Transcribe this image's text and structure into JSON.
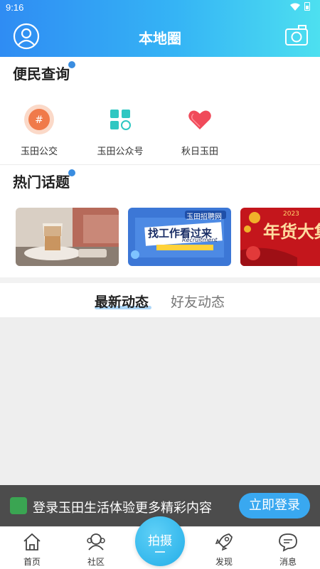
{
  "status_bar": {
    "time": "9:16",
    "wifi_icon": "wifi-icon",
    "battery_icon": "battery-icon"
  },
  "header": {
    "title": "本地圈",
    "left_icon": "user-avatar-icon",
    "right_icon": "camera-icon"
  },
  "services": {
    "title": "便民查询",
    "items": [
      {
        "label": "玉田公交",
        "icon": "hashtag-circle-icon",
        "color": "#f07a4a"
      },
      {
        "label": "玉田公众号",
        "icon": "grid-apps-icon",
        "color": "#2fc7c2"
      },
      {
        "label": "秋日玉田",
        "icon": "heart-icon",
        "color": "#f04a5a"
      }
    ]
  },
  "topics": {
    "title": "热门话题",
    "cards": [
      {
        "icon": "coffee-photo"
      },
      {
        "title": "找工作看过来",
        "badge": "玉田招聘网",
        "subtitle": "Recruitment"
      },
      {
        "title": "年货大集",
        "year": "2023"
      }
    ]
  },
  "feed_tabs": [
    {
      "label": "最新动态",
      "active": true
    },
    {
      "label": "好友动态",
      "active": false
    }
  ],
  "login_banner": {
    "text": "登录玉田生活体验更多精彩内容",
    "button": "立即登录"
  },
  "tabbar": {
    "items": [
      {
        "label": "首页",
        "icon": "home-icon"
      },
      {
        "label": "社区",
        "icon": "community-icon"
      },
      {
        "label": "发现",
        "icon": "rocket-icon"
      },
      {
        "label": "消息",
        "icon": "message-icon"
      }
    ],
    "center": {
      "label": "拍摄"
    }
  },
  "colors": {
    "header_start": "#2f8cf3",
    "header_end": "#4de0f0",
    "accent": "#39a8f0"
  }
}
